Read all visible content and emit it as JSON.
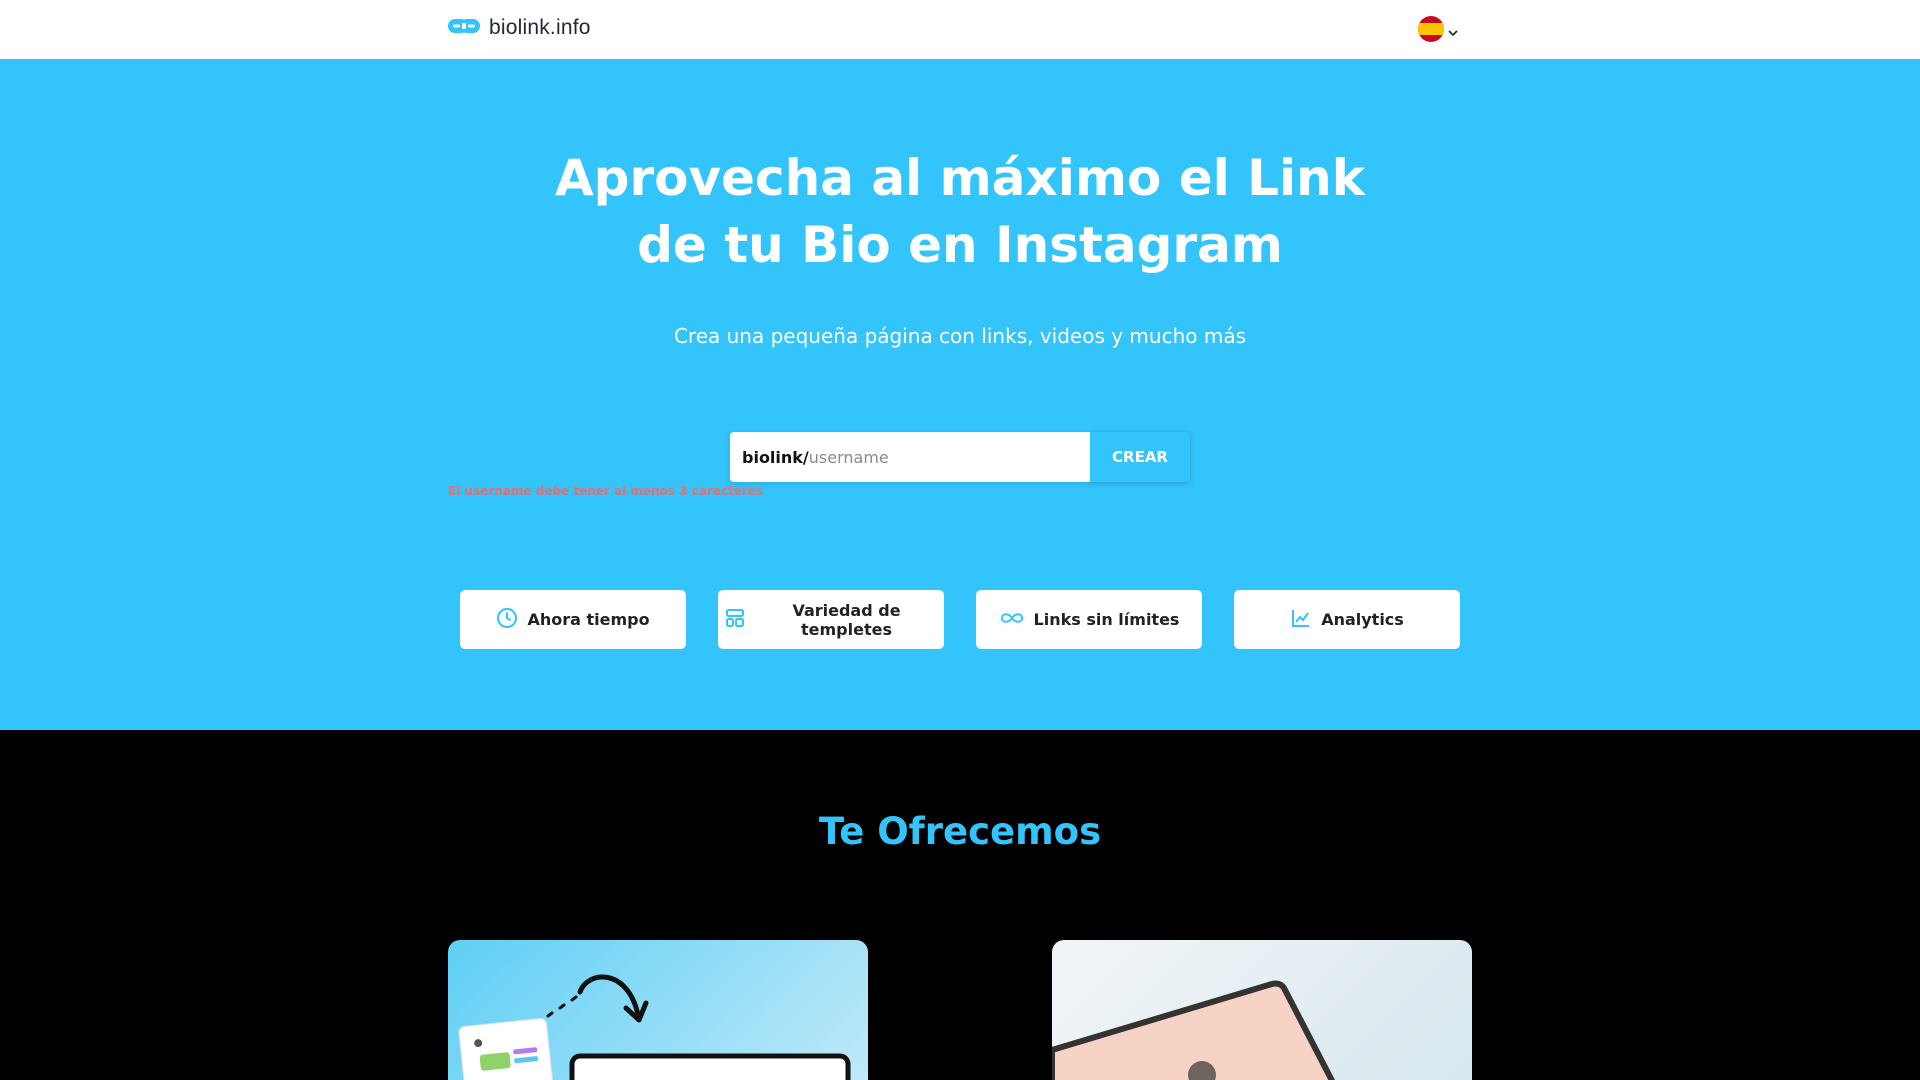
{
  "header": {
    "brand": "biolink.info",
    "language": "Español"
  },
  "hero": {
    "title_line1": "Aprovecha al máximo el Link",
    "title_line2": "de tu Bio en Instagram",
    "subtitle": "Crea una pequeña página con links, videos y mucho más",
    "form": {
      "prefix": "biolink/",
      "placeholder": "username",
      "value": "",
      "submit_label": "CREAR"
    },
    "error": "El username debe tener al menos 3 caracteres",
    "features": [
      {
        "label": "Ahora tiempo",
        "icon": "clock-icon"
      },
      {
        "label": "Variedad de templetes",
        "icon": "layout-icon"
      },
      {
        "label": "Links sin límites",
        "icon": "infinity-icon"
      },
      {
        "label": "Analytics",
        "icon": "chart-line-icon"
      }
    ]
  },
  "offers": {
    "title": "Te Ofrecemos"
  },
  "colors": {
    "brand": "#33c4fc",
    "hero_bg": "#33c4fc",
    "section_bg": "#000000",
    "error": "#f06a6a"
  }
}
